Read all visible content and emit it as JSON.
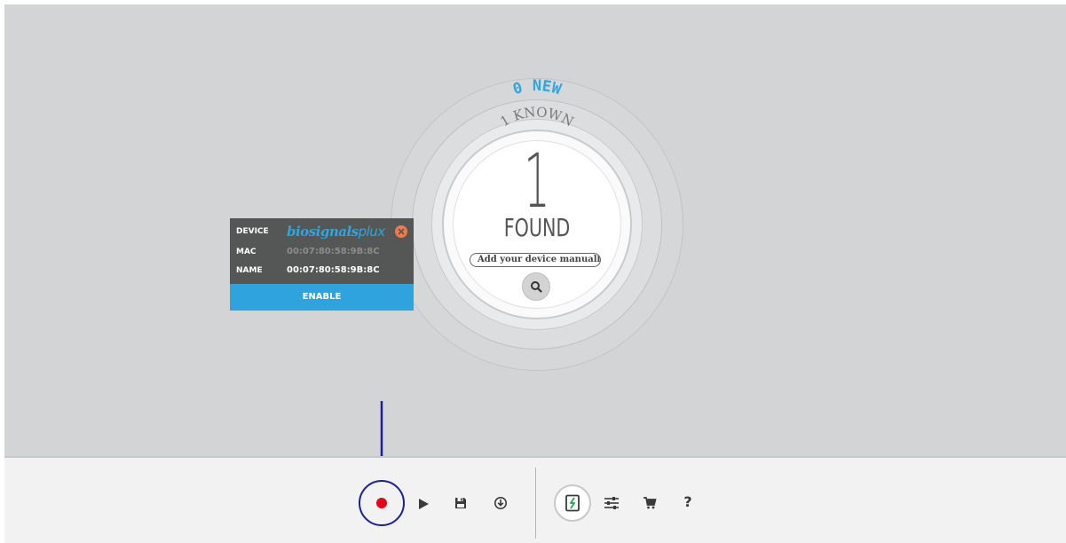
{
  "scanner": {
    "new_label": "0 NEW",
    "known_label": "1 KNOWN",
    "found_count": "1",
    "found_label": "FOUND",
    "add_device_placeholder": "Add your device manually"
  },
  "device_card": {
    "device_label": "DEVICE",
    "device_brand_main": "biosignals",
    "device_brand_suffix": "plux",
    "mac_label": "MAC",
    "mac_value": "00:07:80:58:9B:8C",
    "name_label": "NAME",
    "name_value": "00:07:80:58:9B:8C",
    "enable_label": "ENABLE"
  },
  "toolbar": {
    "icons": [
      "record-icon",
      "play-icon",
      "save-icon",
      "download-icon",
      "device-manager-icon",
      "settings-sliders-icon",
      "cart-icon",
      "help-icon"
    ],
    "help_label": "?"
  },
  "colors": {
    "background": "#d3d4d6",
    "accent_blue": "#2ea3dd",
    "new_label_blue": "#2fa6df",
    "record_red": "#e3001b",
    "annotation_blue": "#1a1f9e",
    "close_orange": "#f07c4a",
    "card_dark": "#555656"
  }
}
